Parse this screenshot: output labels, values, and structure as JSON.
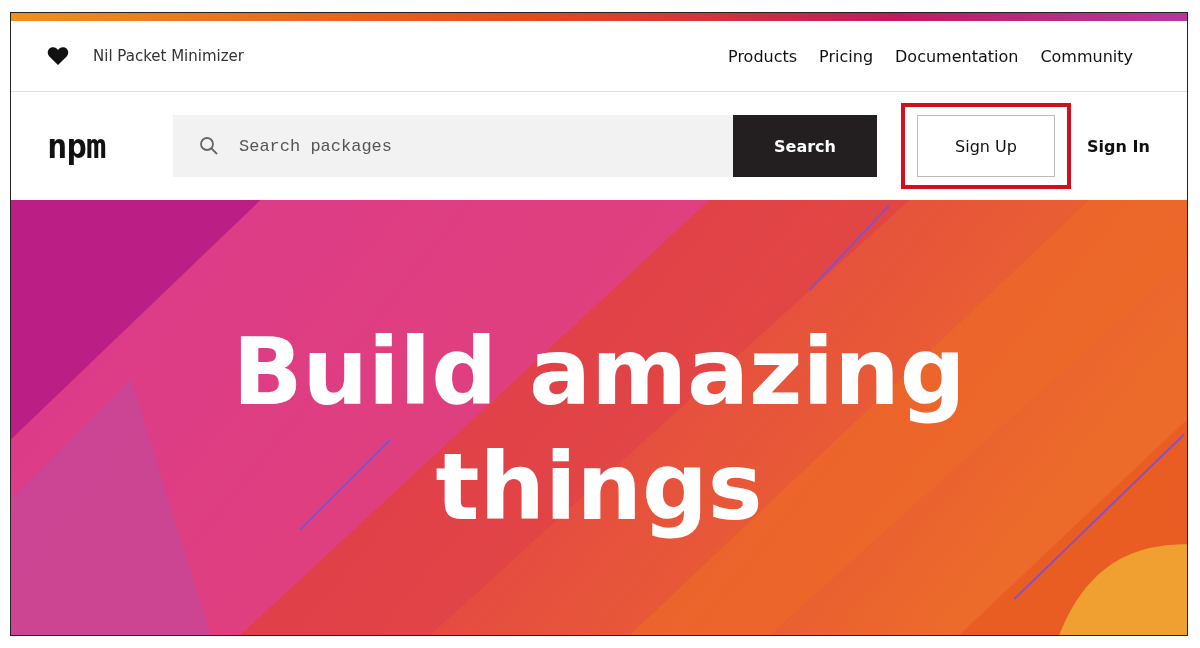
{
  "topbar": {
    "tagline": "Nil Packet Minimizer",
    "nav": [
      {
        "label": "Products"
      },
      {
        "label": "Pricing"
      },
      {
        "label": "Documentation"
      },
      {
        "label": "Community"
      }
    ]
  },
  "searchbar": {
    "logo": "npm",
    "placeholder": "Search packages",
    "button": "Search"
  },
  "auth": [
    {
      "label": "Sign Up",
      "kind": "outlined",
      "highlighted": true
    },
    {
      "label": "Sign In",
      "kind": "link",
      "highlighted": false
    }
  ],
  "hero": {
    "headline": [
      "Build amazing",
      "things"
    ]
  }
}
